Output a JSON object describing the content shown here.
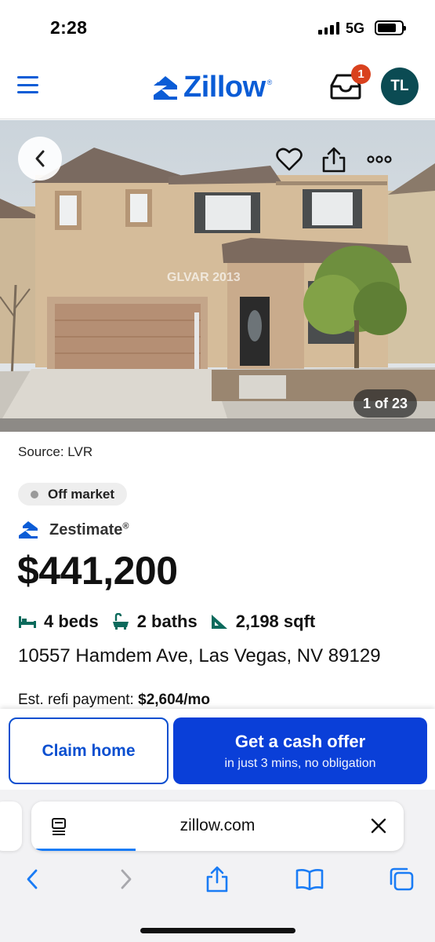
{
  "status_bar": {
    "time": "2:28",
    "network": "5G"
  },
  "header": {
    "logo_text": "Zillow",
    "logo_reg": "®",
    "inbox_badge": "1",
    "avatar_initials": "TL"
  },
  "photo": {
    "counter": "1 of 23",
    "watermark": "GLVAR 2013"
  },
  "listing": {
    "source": "Source: LVR",
    "status": "Off market",
    "zestimate_label": "Zestimate",
    "zestimate_reg": "®",
    "price": "$441,200",
    "beds": "4 beds",
    "baths": "2 baths",
    "sqft": "2,198 sqft",
    "address": "10557 Hamdem Ave, Las Vegas, NV 89129",
    "refi_label": "Est. refi payment:",
    "refi_value": "$2,604/mo"
  },
  "cta": {
    "claim_label": "Claim home",
    "cash_label": "Get a cash offer",
    "cash_sub": "in just 3 mins, no obligation"
  },
  "browser": {
    "url": "zillow.com",
    "load_progress": 0.28
  },
  "colors": {
    "zillow_blue": "#0a5cd6",
    "cta_blue": "#0a3fd8",
    "badge_red": "#d9411e",
    "avatar_teal": "#0b4b53",
    "fact_icon_teal": "#0b6a5c"
  }
}
